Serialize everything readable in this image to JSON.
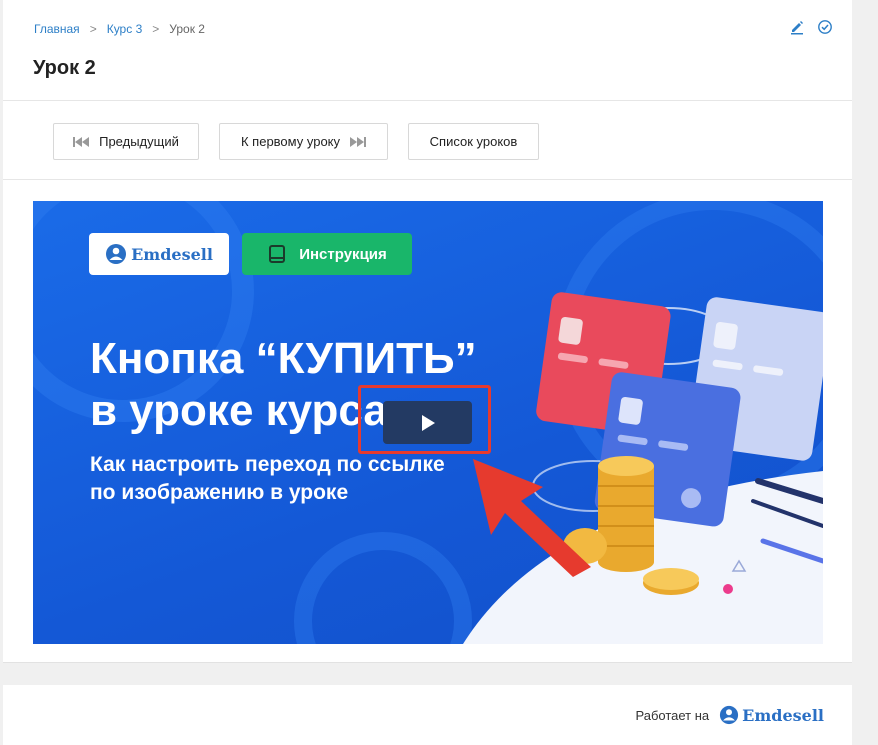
{
  "breadcrumb": {
    "items": [
      {
        "label": "Главная"
      },
      {
        "label": "Курс 3"
      }
    ],
    "separator": ">",
    "current": "Урок 2"
  },
  "page": {
    "title": "Урок 2"
  },
  "toolbar": {
    "icons": [
      "edit-icon",
      "check-circle-icon"
    ]
  },
  "nav": {
    "prev_label": "Предыдущий",
    "first_label": "К первому уроку",
    "list_label": "Список уроков"
  },
  "video": {
    "logo_text": "Emdesell",
    "instruction_label": "Инструкция",
    "title": "Кнопка “КУПИТЬ”\nв уроке курса",
    "subtitle": "Как настроить переход  по ссылке\nпо изображению в уроке",
    "colors": {
      "background": "#1a6be8",
      "accent_green": "#19b66a",
      "highlight_red": "#e63a2e"
    }
  },
  "footer": {
    "powered_label": "Работает на",
    "powered_logo": "Emdesell"
  }
}
